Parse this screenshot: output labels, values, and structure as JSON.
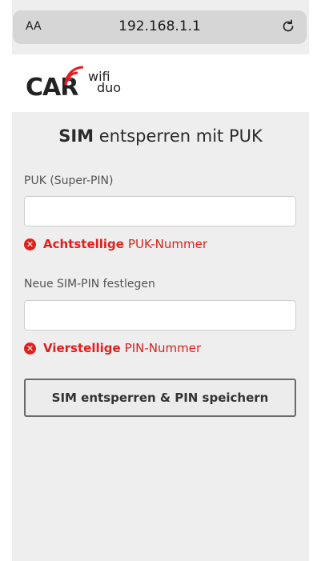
{
  "browser": {
    "text_size_label": "AA",
    "url": "192.168.1.1",
    "reload_icon": "reload-icon"
  },
  "logo": {
    "brand": "CAR",
    "wifi": "wifi",
    "duo": "duo"
  },
  "form": {
    "title_strong": "SIM",
    "title_rest": " entsperren mit PUK",
    "puk_label": "PUK (Super-PIN)",
    "puk_value": "",
    "puk_error_bold": "Achtstellige",
    "puk_error_rest": "PUK-Nummer",
    "pin_label": "Neue SIM-PIN festlegen",
    "pin_value": "",
    "pin_error_bold": "Vierstellige",
    "pin_error_rest": "PIN-Nummer",
    "submit_label": "SIM entsperren & PIN speichern"
  },
  "colors": {
    "error": "#e0201c",
    "logo_arc": "#e31b23"
  }
}
